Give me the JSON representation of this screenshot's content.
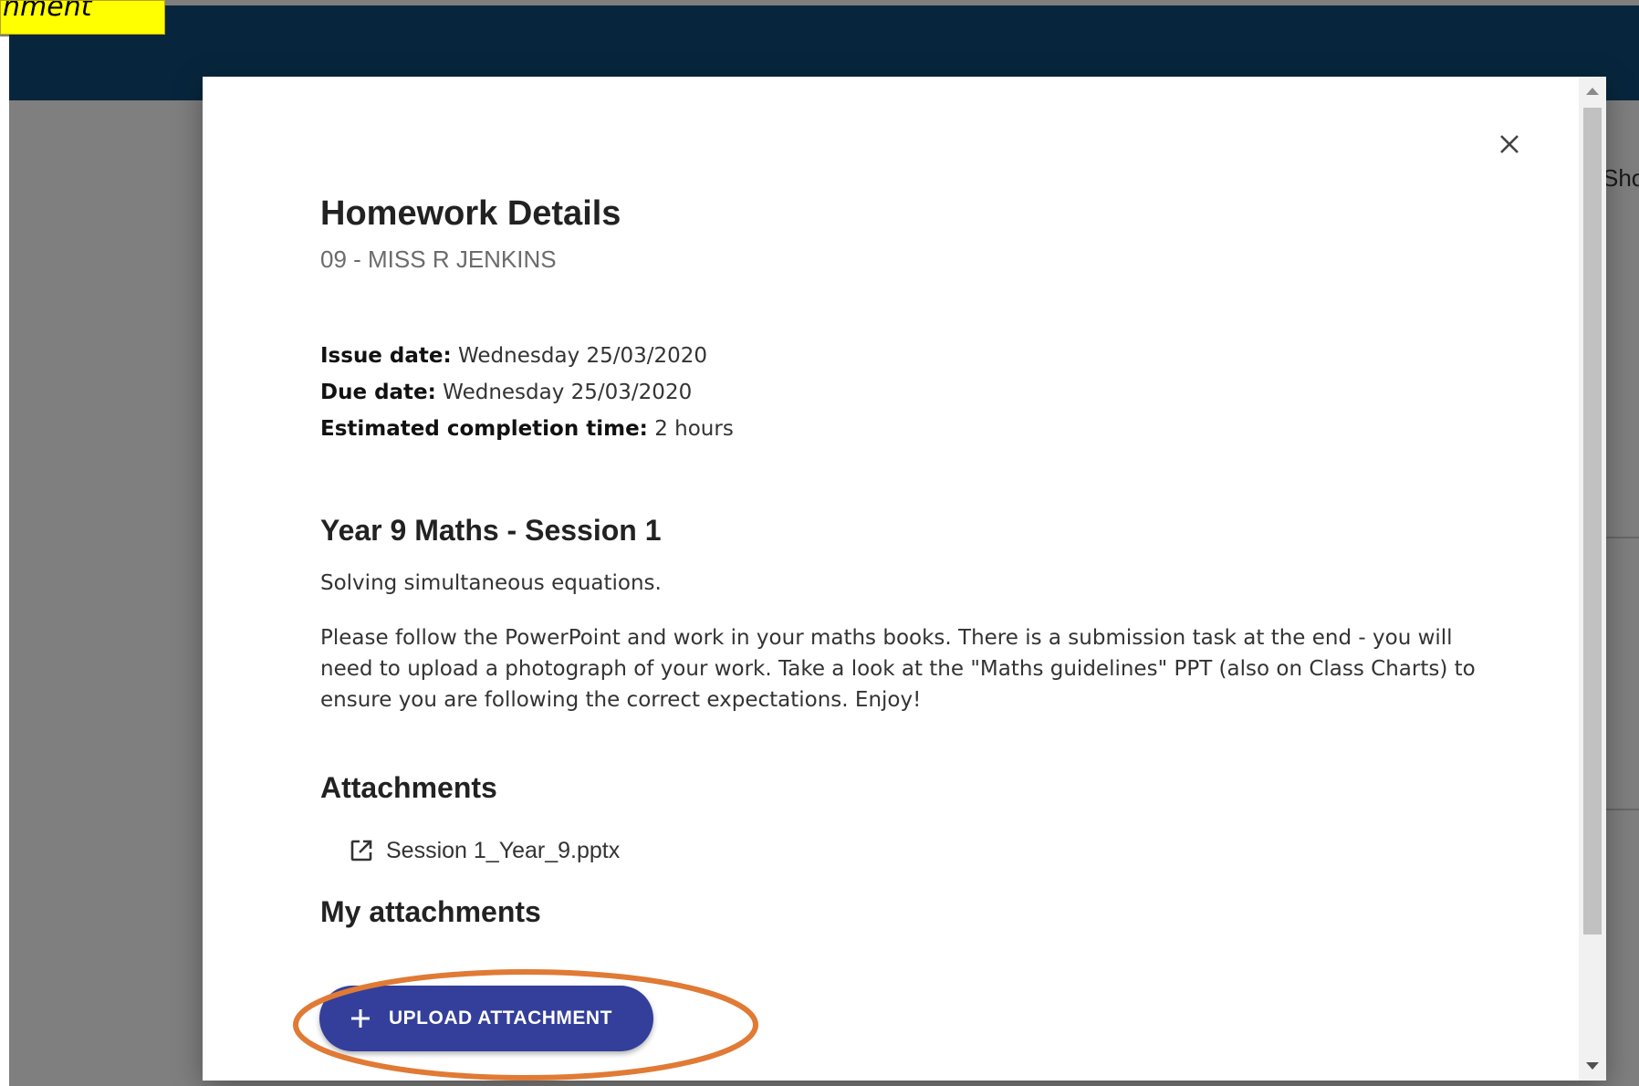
{
  "annotation": {
    "tag_text": "nment",
    "tag_color": "#ffff00",
    "ellipse_color": "#e07a35"
  },
  "background": {
    "header_color": "#0f4c7a",
    "partial_text": "Sho"
  },
  "modal": {
    "close_icon": "close-icon",
    "title": "Homework Details",
    "subtitle": "09 - MISS R JENKINS",
    "meta": {
      "issue_label": "Issue date:",
      "issue_value": "Wednesday 25/03/2020",
      "due_label": "Due date:",
      "due_value": "Wednesday 25/03/2020",
      "time_label": "Estimated completion time:",
      "time_value": "2 hours"
    },
    "lesson_title": "Year 9 Maths - Session 1",
    "description_1": "Solving simultaneous equations.",
    "description_2": "Please follow the PowerPoint and work in your maths books. There is a submission task at the end  - you will need to upload a photograph of your work. Take a look at the \"Maths guidelines\" PPT (also on Class Charts) to ensure you are following the correct expectations. Enjoy!",
    "attachments_heading": "Attachments",
    "attachments": [
      {
        "icon": "open-in-new-icon",
        "name": "Session 1_Year_9.pptx"
      }
    ],
    "my_attachments_heading": "My attachments",
    "upload_button": {
      "icon": "plus-icon",
      "label": "UPLOAD ATTACHMENT",
      "color": "#333f9a"
    }
  }
}
